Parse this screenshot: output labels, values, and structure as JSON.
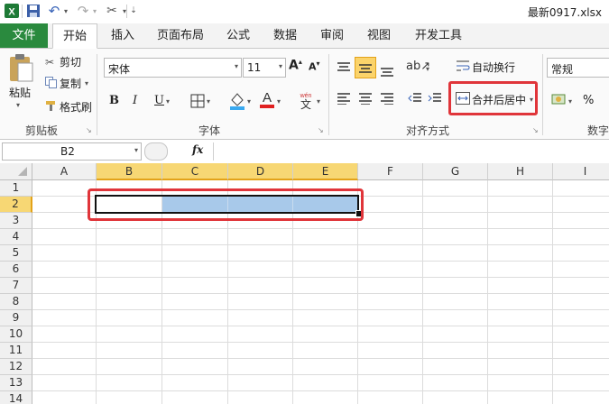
{
  "window": {
    "title": "最新0917.xlsx"
  },
  "tabs": [
    "文件",
    "开始",
    "插入",
    "页面布局",
    "公式",
    "数据",
    "审阅",
    "视图",
    "开发工具"
  ],
  "clipboard": {
    "paste": "粘贴",
    "cut": "剪切",
    "copy": "复制",
    "format_painter": "格式刷",
    "label": "剪贴板"
  },
  "font": {
    "name": "宋体",
    "size": "11",
    "label": "字体",
    "bold": "B",
    "italic": "I",
    "underline": "U"
  },
  "alignment": {
    "wrap_text": "自动换行",
    "merge_center": "合并后居中",
    "label": "对齐方式"
  },
  "number": {
    "format": "常规",
    "label": "数字",
    "percent": "%"
  },
  "formula_bar": {
    "name_box": "B2",
    "fx": "fx",
    "value": ""
  },
  "columns": [
    "A",
    "B",
    "C",
    "D",
    "E",
    "F",
    "G",
    "H",
    "I"
  ],
  "rows": [
    "1",
    "2",
    "3",
    "4",
    "5",
    "6",
    "7",
    "8",
    "9",
    "10",
    "11",
    "12",
    "13",
    "14"
  ],
  "selection": {
    "active_cell": "B2",
    "range": "B2:E2"
  },
  "colors": {
    "file_tab": "#2a8a3e",
    "selection_fill": "#a8c9ea",
    "header_highlight": "#f7d774",
    "annotation": "#e0353a"
  }
}
